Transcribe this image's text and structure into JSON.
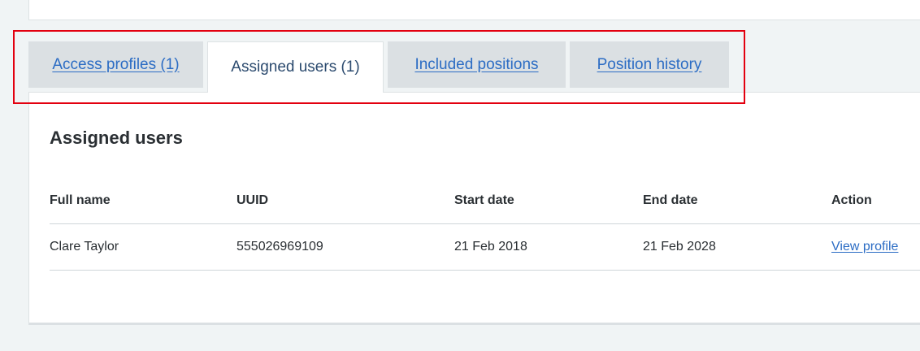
{
  "tabs": [
    {
      "label": "Access profiles (1)",
      "active": false
    },
    {
      "label": "Assigned users (1)",
      "active": true
    },
    {
      "label": "Included positions",
      "active": false
    },
    {
      "label": "Position history",
      "active": false
    }
  ],
  "panel": {
    "title": "Assigned users"
  },
  "table": {
    "columns": [
      "Full name",
      "UUID",
      "Start date",
      "End date",
      "Action"
    ],
    "rows": [
      {
        "full_name": "Clare Taylor",
        "uuid": "555026969109",
        "start_date": "21 Feb 2018",
        "end_date": "21 Feb 2028",
        "action": "View profile"
      }
    ]
  },
  "colors": {
    "highlight": "#e3000f",
    "link": "#2b6cc4",
    "tab_inactive_bg": "#dbe0e3",
    "page_bg": "#f0f4f5"
  }
}
